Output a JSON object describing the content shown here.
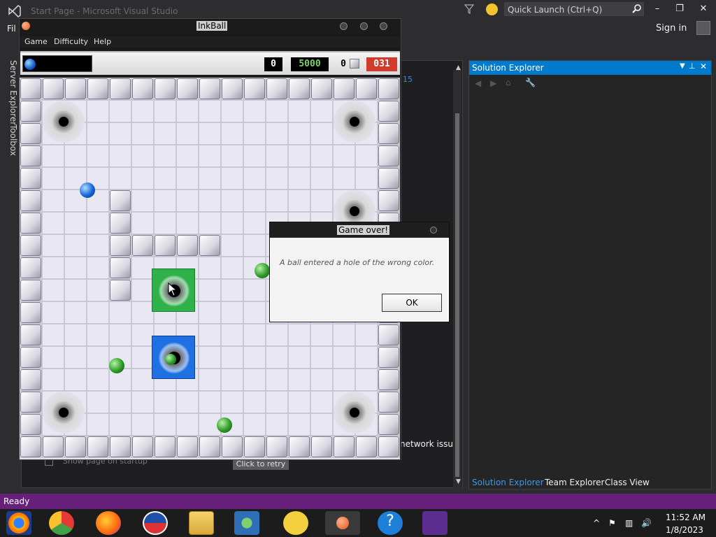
{
  "vs": {
    "title": "Start Page - Microsoft Visual Studio",
    "menu_fragment": "Fil",
    "quick_launch_placeholder": "Quick Launch (Ctrl+Q)",
    "sign_in": "Sign in",
    "minimize": "–",
    "maximize": "❐",
    "close": "✕",
    "vertical_tabs": [
      "Server Explorer",
      "Toolbox"
    ],
    "start_page": {
      "line_number": "15",
      "network_issue": "network issue",
      "retry_button": "Click to retry",
      "show_on_startup": "Show page on startup"
    },
    "solution_explorer": {
      "title": "Solution Explorer",
      "tabs": [
        "Solution Explorer",
        "Team Explorer",
        "Class View"
      ]
    },
    "status_bar": "Ready"
  },
  "inkball": {
    "title": "InkBall",
    "menu": [
      "Game",
      "Difficulty",
      "Help"
    ],
    "hud": {
      "score": "0",
      "high_score": "5000",
      "balls_remaining": "0",
      "timer": "031"
    },
    "dialog": {
      "title": "Game over!",
      "message": "A ball entered a hole of the wrong color.",
      "ok_button": "OK"
    }
  },
  "taskbar": {
    "apps": [
      "vlc-icon",
      "chrome-icon",
      "firefox-icon",
      "obama-logo-icon",
      "file-explorer-icon",
      "network-icon",
      "emoji-icon",
      "inkball-icon",
      "help-icon",
      "visual-studio-icon"
    ],
    "time": "11:52 AM",
    "date": "1/8/2023"
  },
  "colors": {
    "accent": "#007acc",
    "status_bar": "#68217a",
    "timer_red": "#d13b2e",
    "high_score_green": "#7bd36b"
  }
}
